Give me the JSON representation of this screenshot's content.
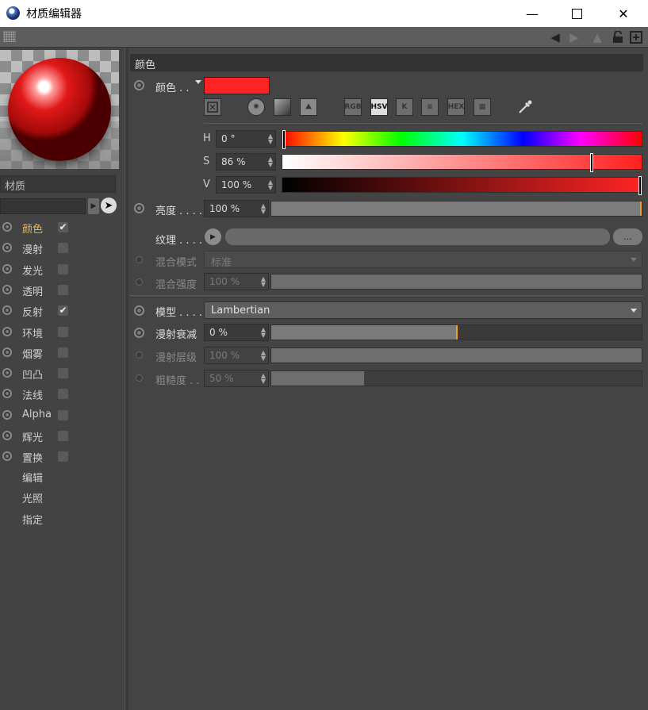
{
  "window": {
    "title": "材质编辑器",
    "minimize_icon": "minimize-icon",
    "maximize_icon": "maximize-icon",
    "close_icon": "close-icon"
  },
  "toolbar": {
    "icons": [
      "back-arrow-icon",
      "forward-arrow-icon",
      "up-arrow-icon",
      "lock-icon",
      "new-window-icon"
    ]
  },
  "left": {
    "material_name": "材质",
    "channels": [
      {
        "label": "颜色",
        "checked": true,
        "active": true
      },
      {
        "label": "漫射",
        "checked": false
      },
      {
        "label": "发光",
        "checked": false
      },
      {
        "label": "透明",
        "checked": false
      },
      {
        "label": "反射",
        "checked": true
      },
      {
        "label": "环境",
        "checked": false
      },
      {
        "label": "烟雾",
        "checked": false
      },
      {
        "label": "凹凸",
        "checked": false
      },
      {
        "label": "法线",
        "checked": false
      },
      {
        "label": "Alpha",
        "checked": false
      },
      {
        "label": "辉光",
        "checked": false
      },
      {
        "label": "置换",
        "checked": false
      }
    ],
    "extra": [
      "编辑",
      "光照",
      "指定"
    ]
  },
  "color": {
    "section_title": "颜色",
    "color_label": "颜色 . .",
    "swatch_color": "#ff2424",
    "modes": [
      "RGB",
      "HSV",
      "K",
      "≡",
      "HEX",
      "▦"
    ],
    "active_mode": "HSV",
    "h_label": "H",
    "h_value": "0 °",
    "h_fraction": 0.0,
    "s_label": "S",
    "s_value": "86 %",
    "s_fraction": 0.86,
    "v_label": "V",
    "v_value": "100 %",
    "v_fraction": 1.0,
    "brightness_label": "亮度 . . . .",
    "brightness_value": "100 %",
    "brightness_fraction": 1.0,
    "texture_label": "纹理 . . . .",
    "texture_more": "...",
    "blend_mode_label": "混合模式",
    "blend_mode_value": "标准",
    "blend_strength_label": "混合强度",
    "blend_strength_value": "100 %",
    "blend_strength_fraction": 1.0
  },
  "model": {
    "model_label": "模型 . . . .",
    "model_value": "Lambertian",
    "falloff_label": "漫射衰减",
    "falloff_value": "0 %",
    "falloff_fraction": 0.5,
    "level_label": "漫射层级",
    "level_value": "100 %",
    "level_fraction": 1.0,
    "roughness_label": "粗糙度 . .",
    "roughness_value": "50 %",
    "roughness_fraction": 0.25
  }
}
